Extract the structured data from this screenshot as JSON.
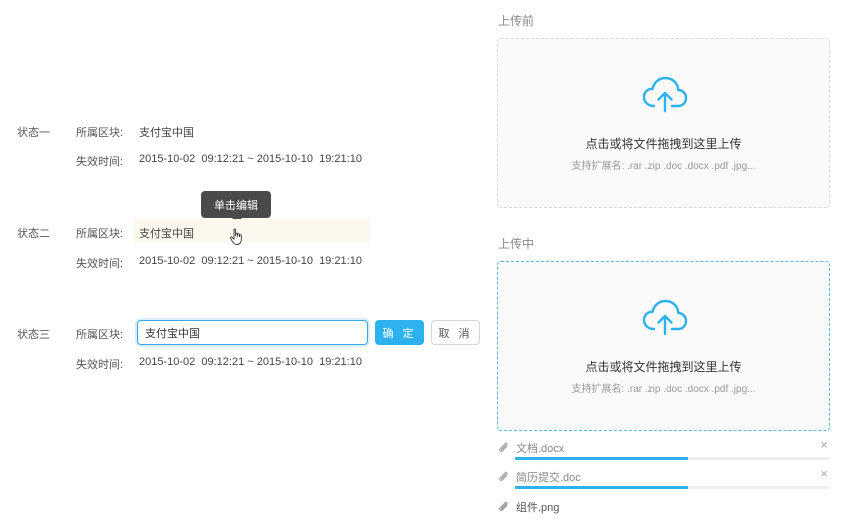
{
  "edit_states": [
    {
      "state_label": "状态一",
      "block_label": "所属区块:",
      "block_value": "支付宝中国",
      "expire_label": "失效时间:",
      "expire_value": "2015-10-02  09:12:21 ~ 2015-10-10  19:21:10"
    },
    {
      "state_label": "状态二",
      "block_label": "所属区块:",
      "block_value": "支付宝中国",
      "expire_label": "失效时间:",
      "expire_value": "2015-10-02  09:12:21 ~ 2015-10-10  19:21:10",
      "tooltip": "单击编辑"
    },
    {
      "state_label": "状态三",
      "block_label": "所属区块:",
      "block_input_value": "支付宝中国",
      "confirm_label": "确 定",
      "cancel_label": "取 消",
      "expire_label": "失效时间:",
      "expire_value": "2015-10-02  09:12:21 ~ 2015-10-10  19:21:10"
    }
  ],
  "upload_before": {
    "title": "上传前",
    "drop_title": "点击或将文件拖拽到这里上传",
    "drop_hint": "支持扩展名: .rar .zip .doc .docx .pdf .jpg..."
  },
  "upload_during": {
    "title": "上传中",
    "drop_title": "点击或将文件拖拽到这里上传",
    "drop_hint": "支持扩展名: .rar .zip .doc .docx .pdf .jpg...",
    "files": [
      {
        "name": "文档.docx",
        "progress": 0.55,
        "icon": "paperclip-icon"
      },
      {
        "name": "简历提交.doc",
        "progress": 0.55,
        "icon": "paperclip-icon"
      },
      {
        "name": "组件.png",
        "icon": "paperclip-icon"
      }
    ]
  },
  "colors": {
    "accent": "#2db1ef",
    "hover_bg": "#fdf8ee",
    "tooltip_bg": "#4a4a4a"
  }
}
